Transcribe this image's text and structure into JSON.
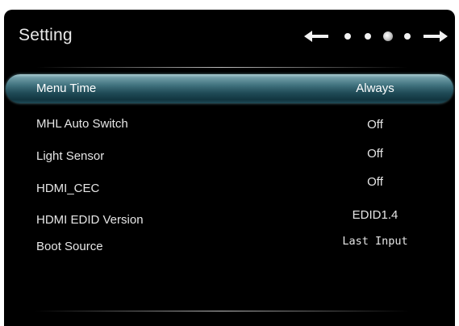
{
  "header": {
    "title": "Setting"
  },
  "pager": {
    "left_icon": "arrow-left-icon",
    "right_icon": "arrow-right-icon",
    "dots": 4,
    "active_dot": 3,
    "dot_color": "#f2f2f2"
  },
  "colors": {
    "background": "#000000",
    "highlight": "#2a5a66",
    "text": "#e6e6e6"
  },
  "settings": [
    {
      "label": "Menu Time",
      "value": "Always",
      "selected": true
    },
    {
      "label": "MHL Auto Switch",
      "value": "Off"
    },
    {
      "label": "Light Sensor",
      "value": "Off"
    },
    {
      "label": "HDMI_CEC",
      "value": "Off"
    },
    {
      "label": "HDMI EDID Version",
      "value": "EDID1.4"
    },
    {
      "label": "Boot Source",
      "value": "Last Input"
    }
  ]
}
